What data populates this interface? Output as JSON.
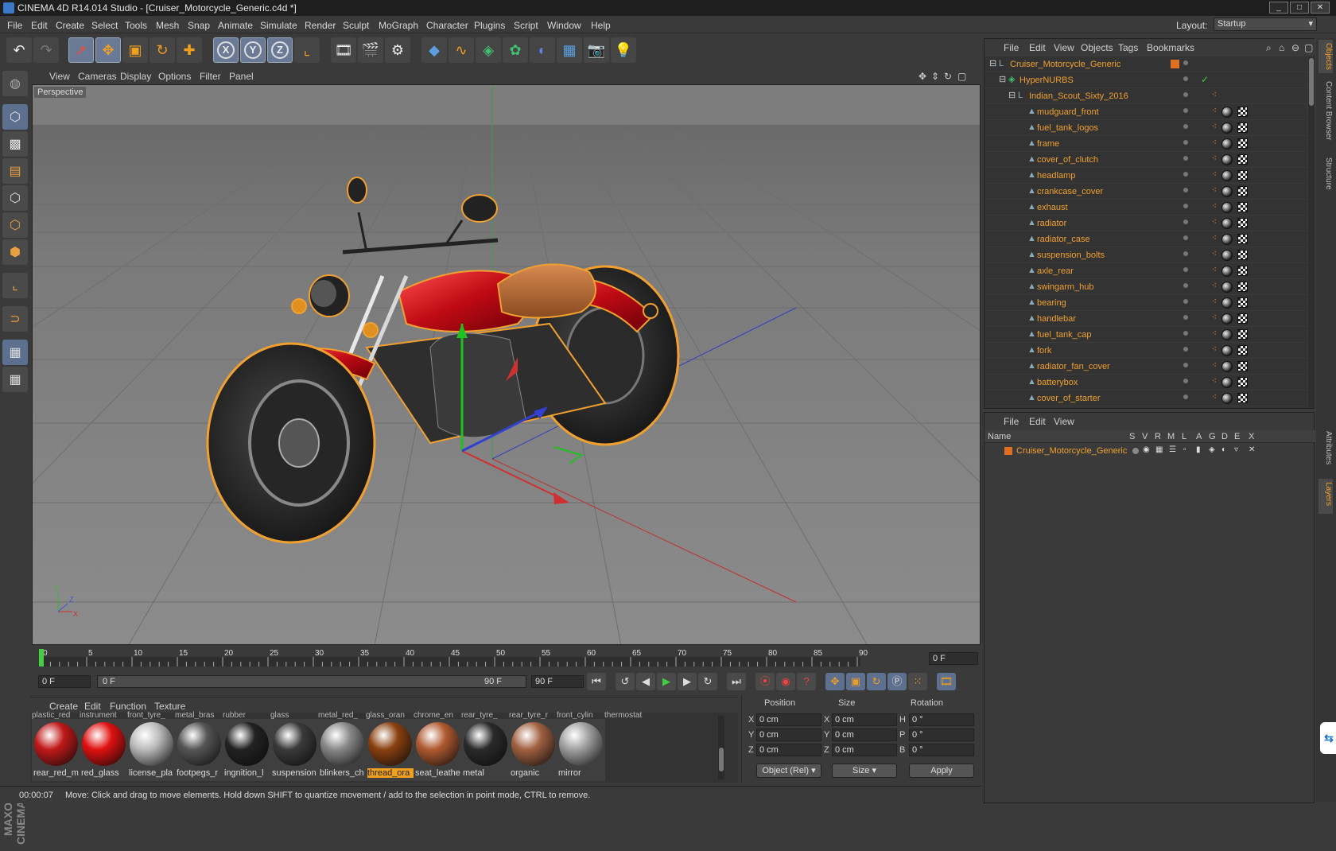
{
  "window": {
    "title": "CINEMA 4D R14.014 Studio - [Cruiser_Motorcycle_Generic.c4d *]"
  },
  "menubar": {
    "items": [
      "File",
      "Edit",
      "Create",
      "Select",
      "Tools",
      "Mesh",
      "Snap",
      "Animate",
      "Simulate",
      "Render",
      "Sculpt",
      "MoGraph",
      "Character",
      "Plugins",
      "Script",
      "Window",
      "Help"
    ],
    "layout_label": "Layout:",
    "layout_value": "Startup"
  },
  "toolbar": {
    "icons": [
      "undo-icon",
      "redo-icon",
      "live-selection-icon",
      "move-icon",
      "scale-icon",
      "rotate-icon",
      "create-object-icon",
      "x-axis-lock-icon",
      "y-axis-lock-icon",
      "z-axis-lock-icon",
      "coordinate-system-icon",
      "render-view-icon",
      "render-picture-viewer-icon",
      "edit-render-settings-icon",
      "cube-icon",
      "spline-pen-icon",
      "subdivision-surface-icon",
      "array-icon",
      "deformer-icon",
      "floor-icon",
      "camera-icon",
      "light-icon"
    ],
    "axis_labels": [
      "X",
      "Y",
      "Z"
    ]
  },
  "left_tools": {
    "icons": [
      "make-editable-icon",
      "model-mode-icon",
      "texture-mode-icon",
      "workplane-mode-icon",
      "points-mode-icon",
      "edges-mode-icon",
      "polygons-mode-icon",
      "axis-mode-icon",
      "tweak-mode-icon",
      "snap-icon",
      "locked-workplane-icon"
    ],
    "logo": "MAXON CINEMA4D"
  },
  "viewport": {
    "menu": [
      "View",
      "Cameras",
      "Display",
      "Options",
      "Filter",
      "Panel"
    ],
    "label": "Perspective",
    "axis_gizmo": {
      "x": "X",
      "y": "Y",
      "z": "Z"
    }
  },
  "timeline": {
    "ticks": [
      "0",
      "5",
      "10",
      "15",
      "20",
      "25",
      "30",
      "35",
      "40",
      "45",
      "50",
      "55",
      "60",
      "65",
      "70",
      "75",
      "80",
      "85",
      "90"
    ],
    "end_field": "0 F"
  },
  "transport": {
    "start": "0 F",
    "range_start": "0 F",
    "range_end": "90 F",
    "end": "90 F"
  },
  "materials": {
    "menu": [
      "Create",
      "Edit",
      "Function",
      "Texture"
    ],
    "top_row": [
      "plastic_red",
      "instrument",
      "front_tyre_",
      "metal_bras",
      "rubber",
      "glass",
      "metal_red_",
      "glass_oran",
      "chrome_en",
      "rear_tyre_",
      "rear_tyre_r",
      "front_cylin",
      "thermostat"
    ],
    "items": [
      {
        "label": "rear_red_m",
        "color": "#c01818"
      },
      {
        "label": "red_glass",
        "color": "#e01010"
      },
      {
        "label": "license_pla",
        "color": "#bbbbbb"
      },
      {
        "label": "footpegs_r",
        "color": "#555555"
      },
      {
        "label": "ingnition_l",
        "color": "#222222"
      },
      {
        "label": "suspension",
        "color": "#3a3a3a"
      },
      {
        "label": "blinkers_ch",
        "color": "#888888"
      },
      {
        "label": "thread_ora",
        "color": "#8a4010",
        "selected": true
      },
      {
        "label": "seat_leathe",
        "color": "#b05a30"
      },
      {
        "label": "metal",
        "color": "#2a2a2a"
      },
      {
        "label": "organic",
        "color": "#a06040"
      },
      {
        "label": "mirror",
        "color": "#a0a0a0"
      }
    ]
  },
  "coordinates": {
    "headers": {
      "position": "Position",
      "size": "Size",
      "rotation": "Rotation"
    },
    "rows": [
      {
        "pos_axis": "X",
        "pos": "0 cm",
        "size_axis": "X",
        "size": "0 cm",
        "rot_axis": "H",
        "rot": "0 °"
      },
      {
        "pos_axis": "Y",
        "pos": "0 cm",
        "size_axis": "Y",
        "size": "0 cm",
        "rot_axis": "P",
        "rot": "0 °"
      },
      {
        "pos_axis": "Z",
        "pos": "0 cm",
        "size_axis": "Z",
        "size": "0 cm",
        "rot_axis": "B",
        "rot": "0 °"
      }
    ],
    "mode": "Object (Rel)",
    "size_mode": "Size",
    "apply": "Apply"
  },
  "status": {
    "time": "00:00:07",
    "message": "Move: Click and drag to move elements. Hold down SHIFT to quantize movement / add to the selection in point mode, CTRL to remove."
  },
  "object_manager": {
    "menu": [
      "File",
      "Edit",
      "View",
      "Objects",
      "Tags",
      "Bookmarks"
    ],
    "root": "Cruiser_Motorcycle_Generic",
    "hypernurbs": "HyperNURBS",
    "group": "Indian_Scout_Sixty_2016",
    "objects": [
      "mudguard_front",
      "fuel_tank_logos",
      "frame",
      "cover_of_clutch",
      "headlamp",
      "crankcase_cover",
      "exhaust",
      "radiator",
      "radiator_case",
      "suspension_bolts",
      "axle_rear",
      "swingarm_hub",
      "bearing",
      "handlebar",
      "fuel_tank_cap",
      "fork",
      "radiator_fan_cover",
      "batterybox",
      "cover_of_starter"
    ]
  },
  "layer_manager": {
    "menu": [
      "File",
      "Edit",
      "View"
    ],
    "columns": [
      "Name",
      "S",
      "V",
      "R",
      "M",
      "L",
      "A",
      "G",
      "D",
      "E",
      "X"
    ],
    "layer": "Cruiser_Motorcycle_Generic",
    "layer_color": "#e07020"
  },
  "right_tabs": [
    "Objects",
    "Content Browser",
    "Structure",
    "Attributes",
    "Layers"
  ]
}
